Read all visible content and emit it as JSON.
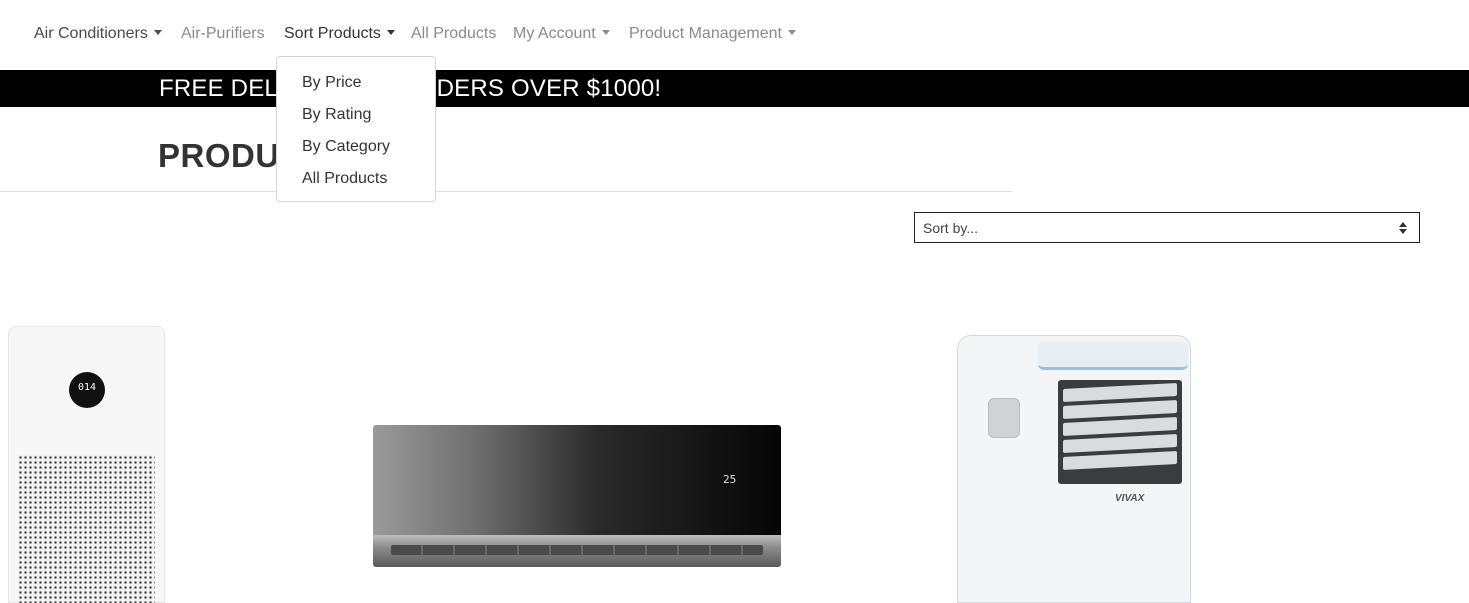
{
  "nav": {
    "items": [
      {
        "label": "Air Conditioners",
        "has_caret": true
      },
      {
        "label": "Air-Purifiers",
        "has_caret": false
      },
      {
        "label": "Sort Products",
        "has_caret": true
      },
      {
        "label": "All Products",
        "has_caret": false
      },
      {
        "label": "My Account",
        "has_caret": true
      },
      {
        "label": "Product Management",
        "has_caret": true
      }
    ]
  },
  "banner": {
    "text": "FREE DELIVERY ON ORDERS OVER $1000!"
  },
  "page": {
    "title": "PRODUCTS"
  },
  "sort": {
    "selected": "Sort by..."
  },
  "dropdown": {
    "items": [
      {
        "label": "By Price"
      },
      {
        "label": "By Rating"
      },
      {
        "label": "By Category"
      },
      {
        "label": "All Products"
      }
    ]
  },
  "products": [
    {
      "icon": "air-purifier-image",
      "display": "014"
    },
    {
      "icon": "split-air-conditioner-image",
      "display": "25"
    },
    {
      "icon": "portable-air-conditioner-image",
      "logo": "VIVAX"
    }
  ],
  "colors": {
    "banner_bg": "#000000",
    "banner_text": "#ffffff",
    "nav_text": "#8a8a8a"
  }
}
